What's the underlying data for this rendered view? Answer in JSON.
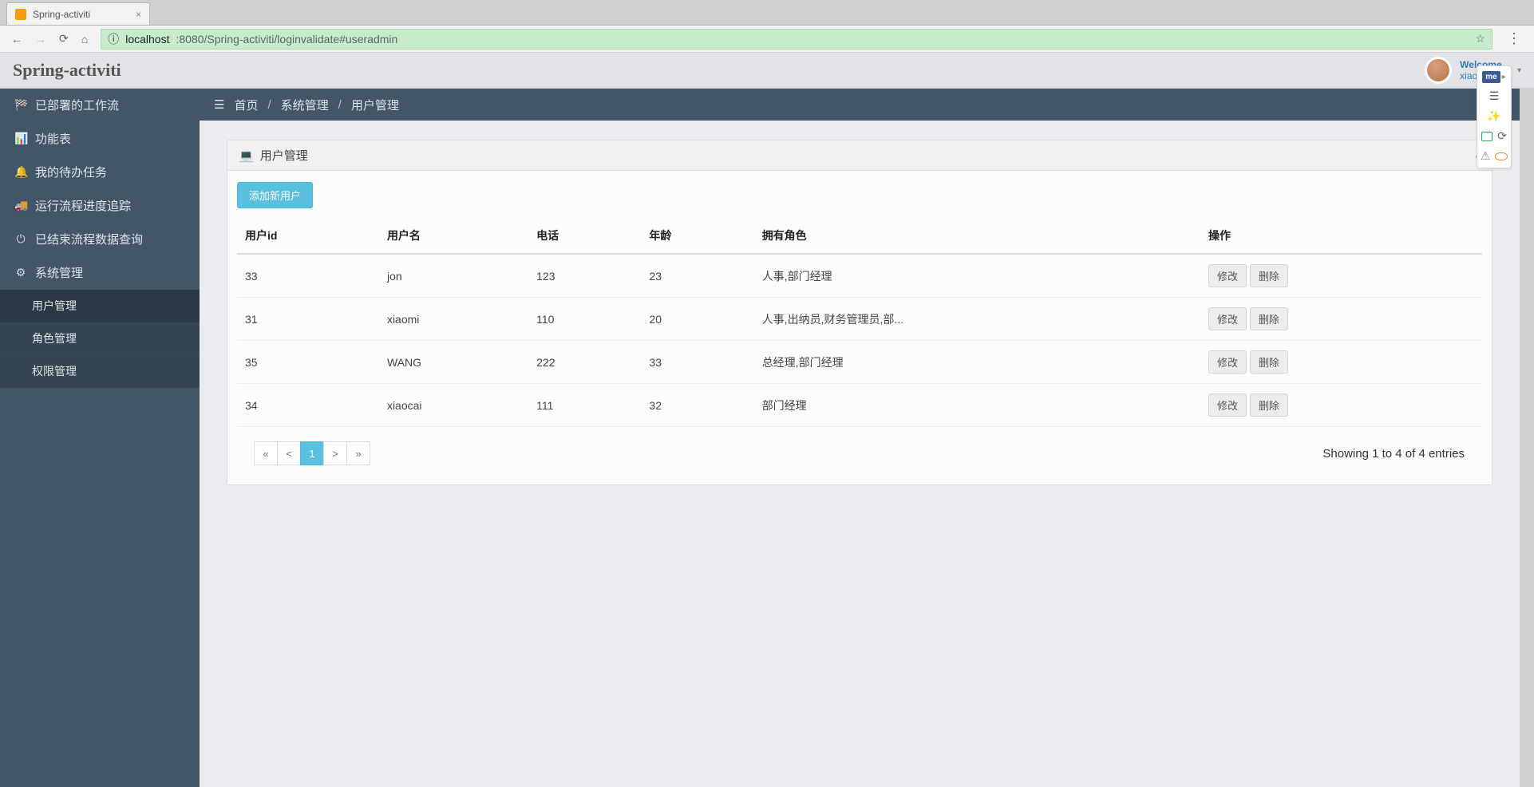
{
  "browser": {
    "tab_title": "Spring-activiti",
    "url_host": "localhost",
    "url_rest": ":8080/Spring-activiti/loginvalidate#useradmin"
  },
  "header": {
    "brand": "Spring-activiti",
    "welcome": "Welcome,",
    "username": "xiaomi"
  },
  "sidebar": {
    "items": [
      {
        "icon": "dashboard",
        "label": "已部署的工作流"
      },
      {
        "icon": "bar-chart",
        "label": "功能表"
      },
      {
        "icon": "bell",
        "label": "我的待办任务"
      },
      {
        "icon": "truck",
        "label": "运行流程进度追踪"
      },
      {
        "icon": "power",
        "label": "已结束流程数据查询"
      },
      {
        "icon": "gear",
        "label": "系统管理"
      }
    ],
    "submenu": {
      "items": [
        {
          "label": "用户管理"
        },
        {
          "label": "角色管理"
        },
        {
          "label": "权限管理"
        }
      ]
    }
  },
  "breadcrumb": {
    "home": "首页",
    "section": "系统管理",
    "page": "用户管理"
  },
  "panel": {
    "title": "用户管理",
    "add_btn": "添加新用户",
    "columns": {
      "id": "用户id",
      "name": "用户名",
      "phone": "电话",
      "age": "年龄",
      "roles": "拥有角色",
      "ops": "操作"
    },
    "row_btn_edit": "修改",
    "row_btn_delete": "删除",
    "rows": [
      {
        "id": "33",
        "name": "jon",
        "phone": "123",
        "age": "23",
        "roles": "人事,部门经理"
      },
      {
        "id": "31",
        "name": "xiaomi",
        "phone": "110",
        "age": "20",
        "roles": "人事,出纳员,财务管理员,部..."
      },
      {
        "id": "35",
        "name": "WANG",
        "phone": "222",
        "age": "33",
        "roles": "总经理,部门经理"
      },
      {
        "id": "34",
        "name": "xiaocai",
        "phone": "111",
        "age": "32",
        "roles": "部门经理"
      }
    ],
    "pagination": {
      "first": "«",
      "prev": "<",
      "current": "1",
      "next": ">",
      "last": "»"
    },
    "entries_info": "Showing 1 to 4 of 4 entries"
  }
}
